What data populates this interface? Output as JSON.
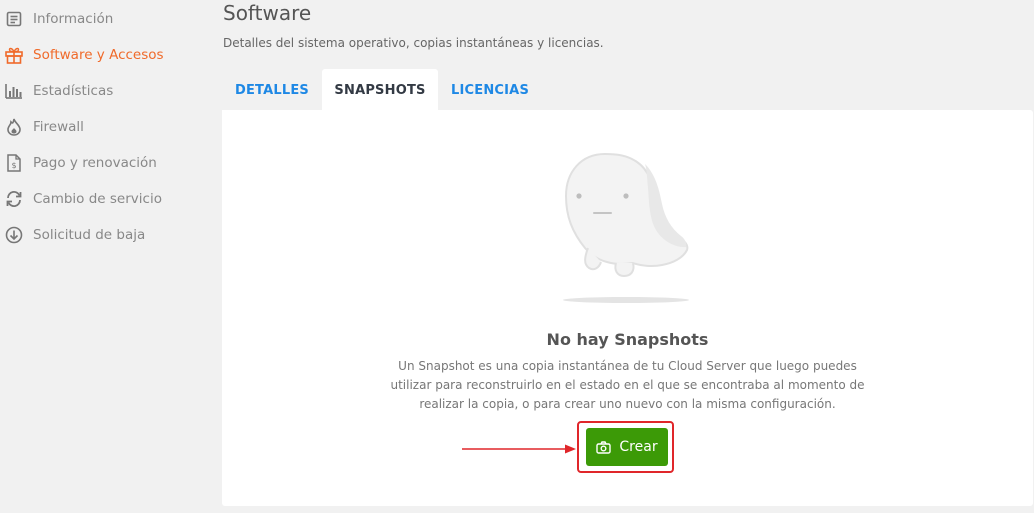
{
  "sidebar": {
    "items": [
      {
        "label": "Información",
        "icon": "document-icon"
      },
      {
        "label": "Software y Accesos",
        "icon": "gift-box-icon",
        "active": true
      },
      {
        "label": "Estadísticas",
        "icon": "bar-chart-icon"
      },
      {
        "label": "Firewall",
        "icon": "flame-icon"
      },
      {
        "label": "Pago y renovación",
        "icon": "invoice-icon"
      },
      {
        "label": "Cambio de servicio",
        "icon": "refresh-icon"
      },
      {
        "label": "Solicitud de baja",
        "icon": "download-circle-icon"
      }
    ]
  },
  "header": {
    "title": "Software",
    "subtitle": "Detalles del sistema operativo, copias instantáneas y licencias."
  },
  "tabs": [
    {
      "label": "DETALLES",
      "active": false
    },
    {
      "label": "SNAPSHOTS",
      "active": true
    },
    {
      "label": "LICENCIAS",
      "active": false
    }
  ],
  "empty_state": {
    "illustration": "ghost-illustration",
    "title": "No hay Snapshots",
    "text": "Un Snapshot es una copia instantánea de tu Cloud Server que luego puedes utilizar para reconstruirlo en el estado en el que se encontraba al momento de realizar la copia, o para crear uno nuevo con la misma configuración."
  },
  "create_button": {
    "label": "Crear",
    "icon": "camera-icon"
  },
  "colors": {
    "accent": "#f06a2a",
    "tab_link": "#1e88e5",
    "button": "#3c9a07",
    "annotation": "#e0262a",
    "background": "#f1f1f1"
  }
}
